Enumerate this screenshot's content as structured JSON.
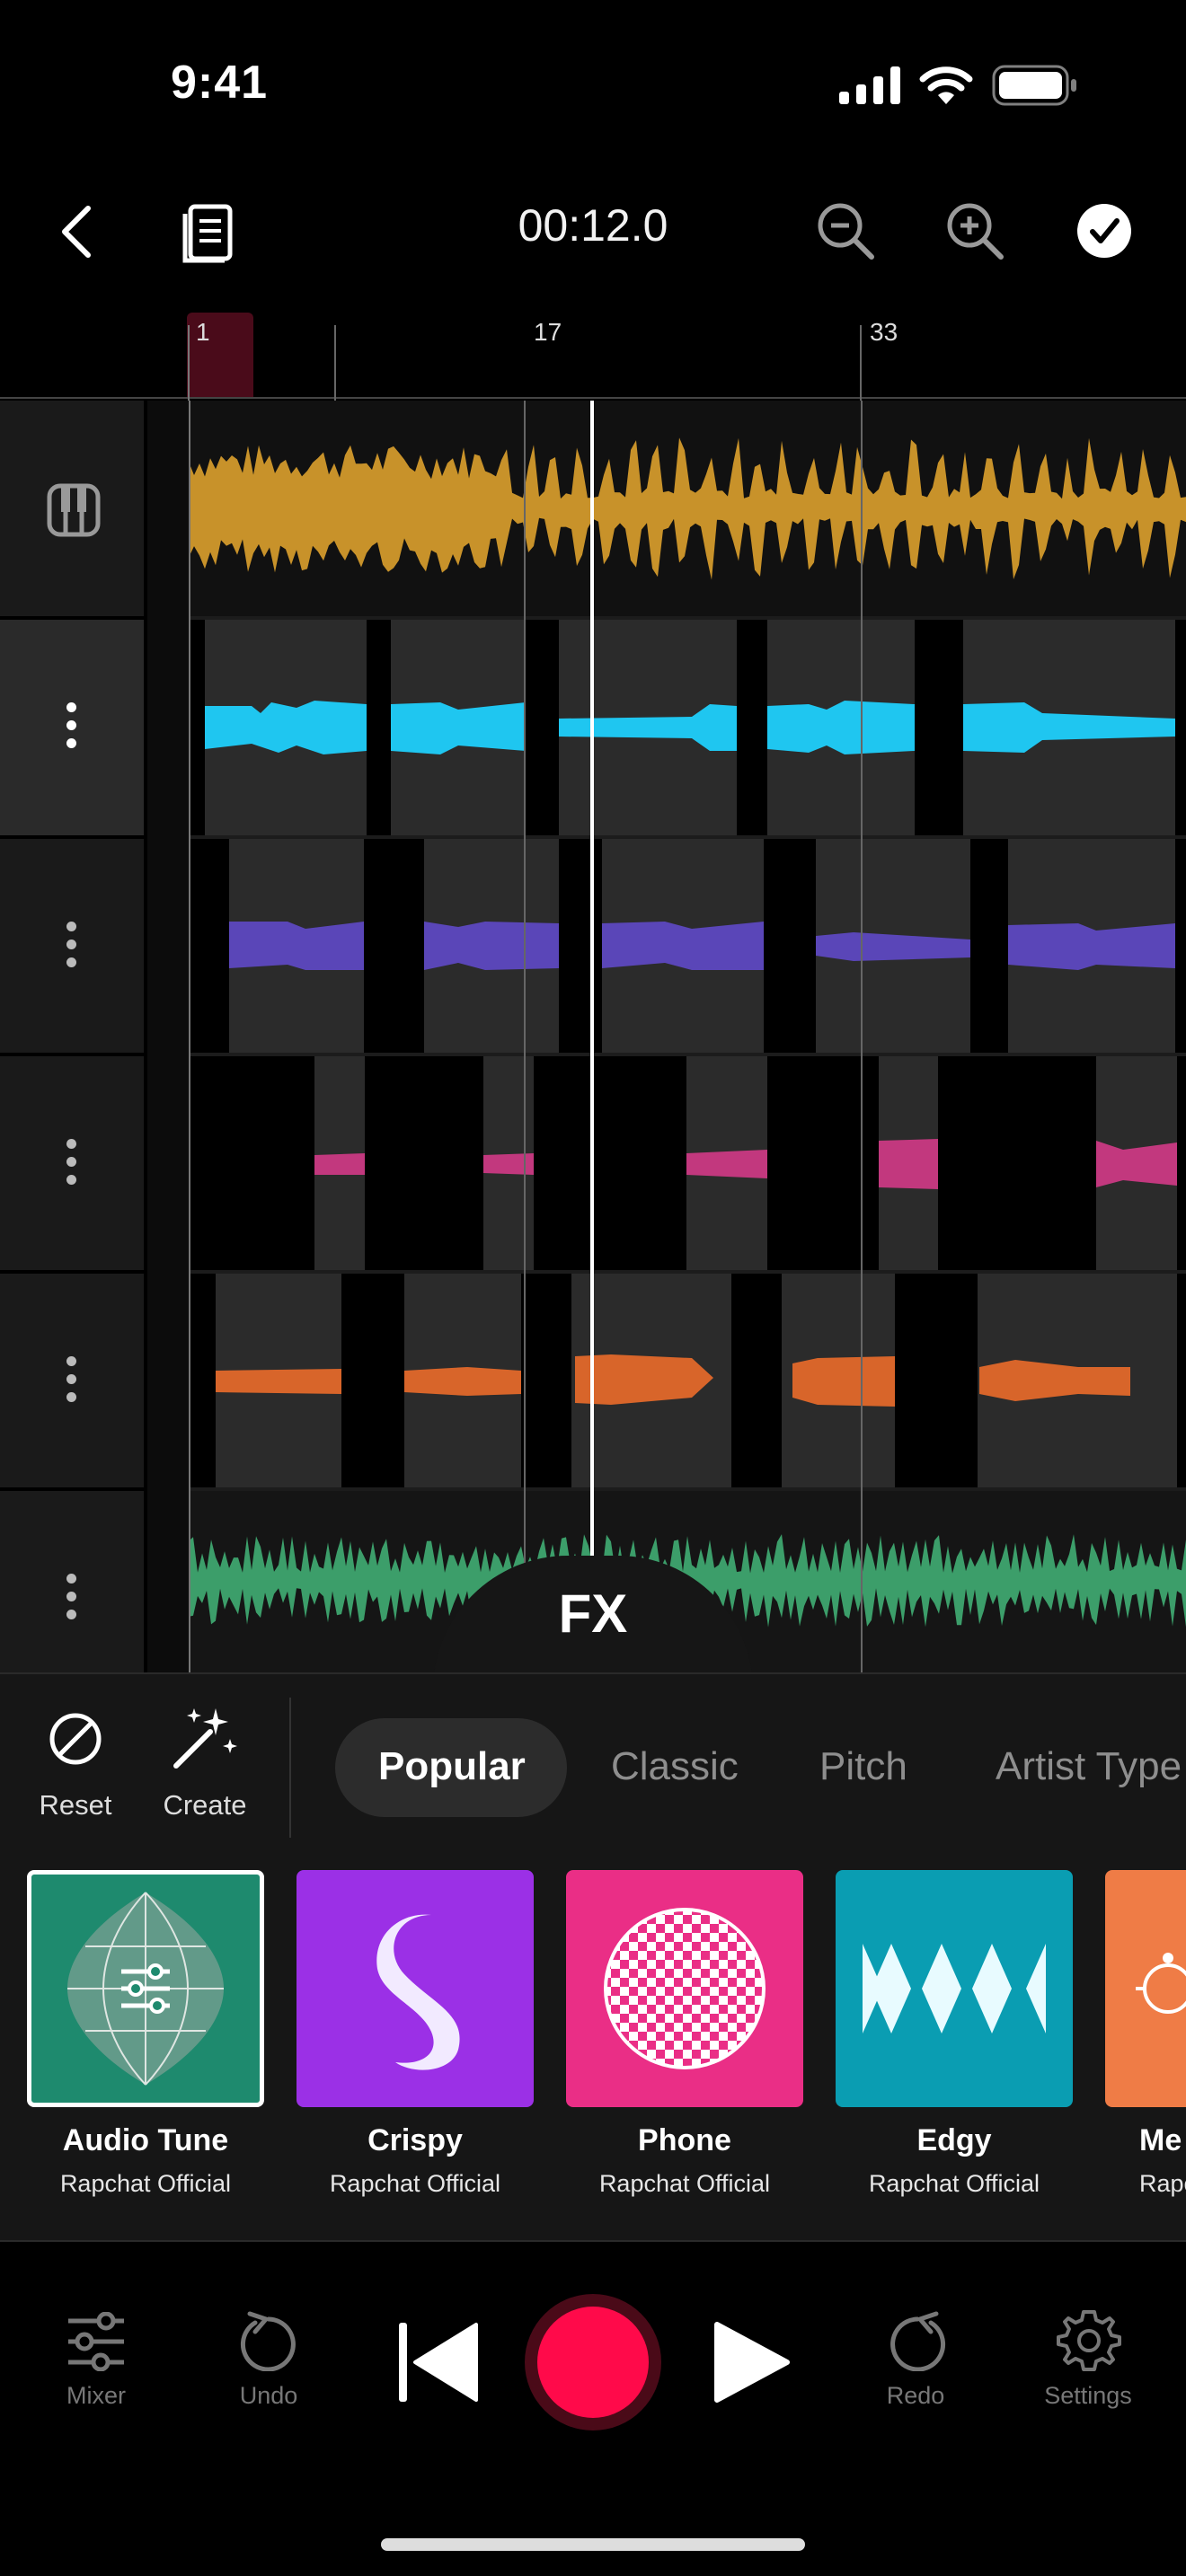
{
  "status_bar": {
    "time": "9:41"
  },
  "toolbar": {
    "timecode": "00:12.0"
  },
  "ruler": {
    "markers": [
      "1",
      "17",
      "33"
    ]
  },
  "overlay": {
    "fx_label": "FX"
  },
  "tools": {
    "reset_label": "Reset",
    "create_label": "Create"
  },
  "tabs": [
    {
      "label": "Popular",
      "selected": true
    },
    {
      "label": "Classic",
      "selected": false
    },
    {
      "label": "Pitch",
      "selected": false
    },
    {
      "label": "Artist Type",
      "selected": false
    }
  ],
  "presets": [
    {
      "name": "Audio Tune",
      "author": "Rapchat Official",
      "color": "#1e8a6e",
      "icon": "sliders-grid-icon",
      "selected": true
    },
    {
      "name": "Crispy",
      "author": "Rapchat Official",
      "color": "#9b30e6",
      "icon": "swirl-icon",
      "selected": false
    },
    {
      "name": "Phone",
      "author": "Rapchat Official",
      "color": "#ea2e86",
      "icon": "checker-sphere-icon",
      "selected": false
    },
    {
      "name": "Edgy",
      "author": "Rapchat Official",
      "color": "#0a9db2",
      "icon": "spikes-icon",
      "selected": false
    },
    {
      "name": "Me",
      "author": "Rapc",
      "color": "#ef7c46",
      "icon": "robot-icon",
      "selected": false
    }
  ],
  "track_colors": [
    "#c8922a",
    "#1fc6f0",
    "#5a46b8",
    "#c2387e",
    "#d8652a",
    "#3c9e6a"
  ],
  "transport": {
    "mixer_label": "Mixer",
    "undo_label": "Undo",
    "redo_label": "Redo",
    "settings_label": "Settings",
    "record_color": "#ff0a4a"
  }
}
